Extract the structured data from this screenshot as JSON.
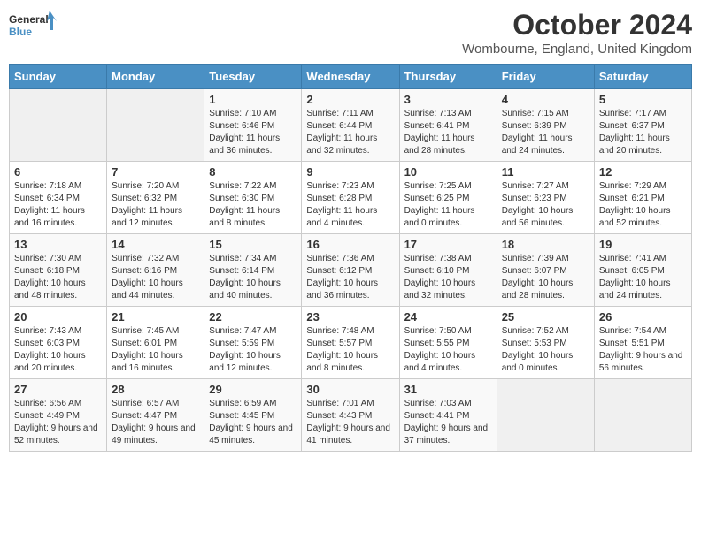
{
  "header": {
    "logo_general": "General",
    "logo_blue": "Blue",
    "month_year": "October 2024",
    "location": "Wombourne, England, United Kingdom"
  },
  "days_of_week": [
    "Sunday",
    "Monday",
    "Tuesday",
    "Wednesday",
    "Thursday",
    "Friday",
    "Saturday"
  ],
  "weeks": [
    [
      {
        "day": "",
        "sunrise": "",
        "sunset": "",
        "daylight": ""
      },
      {
        "day": "",
        "sunrise": "",
        "sunset": "",
        "daylight": ""
      },
      {
        "day": "1",
        "sunrise": "Sunrise: 7:10 AM",
        "sunset": "Sunset: 6:46 PM",
        "daylight": "Daylight: 11 hours and 36 minutes."
      },
      {
        "day": "2",
        "sunrise": "Sunrise: 7:11 AM",
        "sunset": "Sunset: 6:44 PM",
        "daylight": "Daylight: 11 hours and 32 minutes."
      },
      {
        "day": "3",
        "sunrise": "Sunrise: 7:13 AM",
        "sunset": "Sunset: 6:41 PM",
        "daylight": "Daylight: 11 hours and 28 minutes."
      },
      {
        "day": "4",
        "sunrise": "Sunrise: 7:15 AM",
        "sunset": "Sunset: 6:39 PM",
        "daylight": "Daylight: 11 hours and 24 minutes."
      },
      {
        "day": "5",
        "sunrise": "Sunrise: 7:17 AM",
        "sunset": "Sunset: 6:37 PM",
        "daylight": "Daylight: 11 hours and 20 minutes."
      }
    ],
    [
      {
        "day": "6",
        "sunrise": "Sunrise: 7:18 AM",
        "sunset": "Sunset: 6:34 PM",
        "daylight": "Daylight: 11 hours and 16 minutes."
      },
      {
        "day": "7",
        "sunrise": "Sunrise: 7:20 AM",
        "sunset": "Sunset: 6:32 PM",
        "daylight": "Daylight: 11 hours and 12 minutes."
      },
      {
        "day": "8",
        "sunrise": "Sunrise: 7:22 AM",
        "sunset": "Sunset: 6:30 PM",
        "daylight": "Daylight: 11 hours and 8 minutes."
      },
      {
        "day": "9",
        "sunrise": "Sunrise: 7:23 AM",
        "sunset": "Sunset: 6:28 PM",
        "daylight": "Daylight: 11 hours and 4 minutes."
      },
      {
        "day": "10",
        "sunrise": "Sunrise: 7:25 AM",
        "sunset": "Sunset: 6:25 PM",
        "daylight": "Daylight: 11 hours and 0 minutes."
      },
      {
        "day": "11",
        "sunrise": "Sunrise: 7:27 AM",
        "sunset": "Sunset: 6:23 PM",
        "daylight": "Daylight: 10 hours and 56 minutes."
      },
      {
        "day": "12",
        "sunrise": "Sunrise: 7:29 AM",
        "sunset": "Sunset: 6:21 PM",
        "daylight": "Daylight: 10 hours and 52 minutes."
      }
    ],
    [
      {
        "day": "13",
        "sunrise": "Sunrise: 7:30 AM",
        "sunset": "Sunset: 6:18 PM",
        "daylight": "Daylight: 10 hours and 48 minutes."
      },
      {
        "day": "14",
        "sunrise": "Sunrise: 7:32 AM",
        "sunset": "Sunset: 6:16 PM",
        "daylight": "Daylight: 10 hours and 44 minutes."
      },
      {
        "day": "15",
        "sunrise": "Sunrise: 7:34 AM",
        "sunset": "Sunset: 6:14 PM",
        "daylight": "Daylight: 10 hours and 40 minutes."
      },
      {
        "day": "16",
        "sunrise": "Sunrise: 7:36 AM",
        "sunset": "Sunset: 6:12 PM",
        "daylight": "Daylight: 10 hours and 36 minutes."
      },
      {
        "day": "17",
        "sunrise": "Sunrise: 7:38 AM",
        "sunset": "Sunset: 6:10 PM",
        "daylight": "Daylight: 10 hours and 32 minutes."
      },
      {
        "day": "18",
        "sunrise": "Sunrise: 7:39 AM",
        "sunset": "Sunset: 6:07 PM",
        "daylight": "Daylight: 10 hours and 28 minutes."
      },
      {
        "day": "19",
        "sunrise": "Sunrise: 7:41 AM",
        "sunset": "Sunset: 6:05 PM",
        "daylight": "Daylight: 10 hours and 24 minutes."
      }
    ],
    [
      {
        "day": "20",
        "sunrise": "Sunrise: 7:43 AM",
        "sunset": "Sunset: 6:03 PM",
        "daylight": "Daylight: 10 hours and 20 minutes."
      },
      {
        "day": "21",
        "sunrise": "Sunrise: 7:45 AM",
        "sunset": "Sunset: 6:01 PM",
        "daylight": "Daylight: 10 hours and 16 minutes."
      },
      {
        "day": "22",
        "sunrise": "Sunrise: 7:47 AM",
        "sunset": "Sunset: 5:59 PM",
        "daylight": "Daylight: 10 hours and 12 minutes."
      },
      {
        "day": "23",
        "sunrise": "Sunrise: 7:48 AM",
        "sunset": "Sunset: 5:57 PM",
        "daylight": "Daylight: 10 hours and 8 minutes."
      },
      {
        "day": "24",
        "sunrise": "Sunrise: 7:50 AM",
        "sunset": "Sunset: 5:55 PM",
        "daylight": "Daylight: 10 hours and 4 minutes."
      },
      {
        "day": "25",
        "sunrise": "Sunrise: 7:52 AM",
        "sunset": "Sunset: 5:53 PM",
        "daylight": "Daylight: 10 hours and 0 minutes."
      },
      {
        "day": "26",
        "sunrise": "Sunrise: 7:54 AM",
        "sunset": "Sunset: 5:51 PM",
        "daylight": "Daylight: 9 hours and 56 minutes."
      }
    ],
    [
      {
        "day": "27",
        "sunrise": "Sunrise: 6:56 AM",
        "sunset": "Sunset: 4:49 PM",
        "daylight": "Daylight: 9 hours and 52 minutes."
      },
      {
        "day": "28",
        "sunrise": "Sunrise: 6:57 AM",
        "sunset": "Sunset: 4:47 PM",
        "daylight": "Daylight: 9 hours and 49 minutes."
      },
      {
        "day": "29",
        "sunrise": "Sunrise: 6:59 AM",
        "sunset": "Sunset: 4:45 PM",
        "daylight": "Daylight: 9 hours and 45 minutes."
      },
      {
        "day": "30",
        "sunrise": "Sunrise: 7:01 AM",
        "sunset": "Sunset: 4:43 PM",
        "daylight": "Daylight: 9 hours and 41 minutes."
      },
      {
        "day": "31",
        "sunrise": "Sunrise: 7:03 AM",
        "sunset": "Sunset: 4:41 PM",
        "daylight": "Daylight: 9 hours and 37 minutes."
      },
      {
        "day": "",
        "sunrise": "",
        "sunset": "",
        "daylight": ""
      },
      {
        "day": "",
        "sunrise": "",
        "sunset": "",
        "daylight": ""
      }
    ]
  ]
}
